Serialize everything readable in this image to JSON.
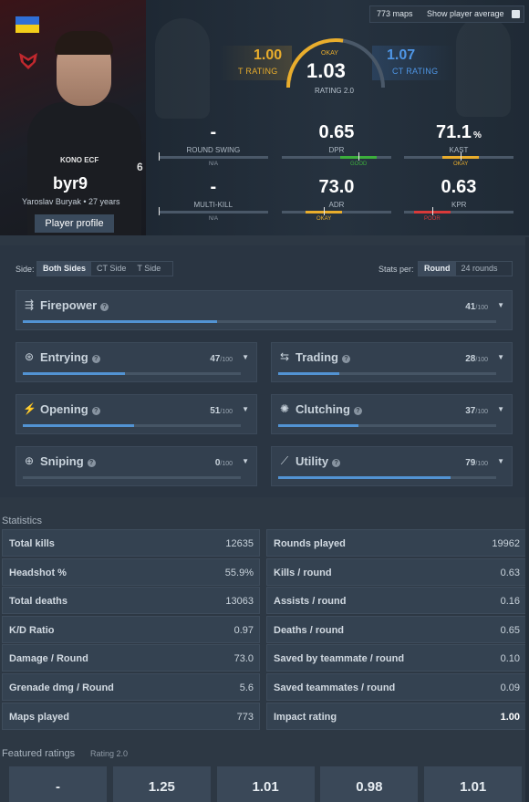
{
  "player": {
    "nickname": "byr9",
    "realname": "Yaroslav Buryak • 27 years",
    "profile_button": "Player profile",
    "country_flag": "ukraine-flag",
    "team_logo": "team-logo",
    "jersey_sponsor": "KONO ECF",
    "jersey_number": "6"
  },
  "header": {
    "maps": "773 maps",
    "show_average": "Show player average",
    "t_rating": "1.00",
    "t_rating_label": "T RATING",
    "ct_rating": "1.07",
    "ct_rating_label": "CT RATING",
    "rating_quality": "OKAY",
    "rating": "1.03",
    "rating_label": "RATING 2.0",
    "rating_gauge_fraction": 0.55
  },
  "stats": [
    {
      "value": "-",
      "unit": "",
      "label": "ROUND SWING",
      "quality": "N/A",
      "quality_color": "#8d98a4",
      "marker": 0.0
    },
    {
      "value": "0.65",
      "unit": "",
      "label": "DPR",
      "quality": "GOOD",
      "quality_color": "#3cae3c",
      "marker": 0.7
    },
    {
      "value": "71.1",
      "unit": "%",
      "label": "KAST",
      "quality": "OKAY",
      "quality_color": "#e9ad2c",
      "marker": 0.52
    },
    {
      "value": "-",
      "unit": "",
      "label": "MULTI-KILL",
      "quality": "N/A",
      "quality_color": "#8d98a4",
      "marker": 0.0
    },
    {
      "value": "73.0",
      "unit": "",
      "label": "ADR",
      "quality": "OKAY",
      "quality_color": "#e9ad2c",
      "marker": 0.38
    },
    {
      "value": "0.63",
      "unit": "",
      "label": "KPR",
      "quality": "POOR",
      "quality_color": "#d83a3a",
      "marker": 0.26
    }
  ],
  "filters": {
    "side_label": "Side:",
    "side_tabs": [
      "Both Sides",
      "CT Side",
      "T Side"
    ],
    "side_active": 0,
    "per_label": "Stats per:",
    "per_tabs": [
      "Round",
      "24 rounds"
    ],
    "per_active": 0
  },
  "categories": [
    {
      "name": "Firepower",
      "score": "41",
      "max": "/100",
      "icon": "firepower-icon",
      "glyph": "⇶",
      "fill": 0.41
    },
    {
      "name": "Entrying",
      "score": "47",
      "max": "/100",
      "icon": "entrying-icon",
      "glyph": "⊛",
      "fill": 0.47
    },
    {
      "name": "Trading",
      "score": "28",
      "max": "/100",
      "icon": "trading-icon",
      "glyph": "⇆",
      "fill": 0.28
    },
    {
      "name": "Opening",
      "score": "51",
      "max": "/100",
      "icon": "opening-icon",
      "glyph": "⚡",
      "fill": 0.51
    },
    {
      "name": "Clutching",
      "score": "37",
      "max": "/100",
      "icon": "clutching-icon",
      "glyph": "✺",
      "fill": 0.37
    },
    {
      "name": "Sniping",
      "score": "0",
      "max": "/100",
      "icon": "sniping-icon",
      "glyph": "⊕",
      "fill": 0.0
    },
    {
      "name": "Utility",
      "score": "79",
      "max": "/100",
      "icon": "utility-icon",
      "glyph": "⟋",
      "fill": 0.79
    }
  ],
  "statistics": {
    "title": "Statistics",
    "left": [
      {
        "k": "Total kills",
        "v": "12635"
      },
      {
        "k": "Headshot %",
        "v": "55.9%"
      },
      {
        "k": "Total deaths",
        "v": "13063"
      },
      {
        "k": "K/D Ratio",
        "v": "0.97"
      },
      {
        "k": "Damage / Round",
        "v": "73.0"
      },
      {
        "k": "Grenade dmg / Round",
        "v": "5.6"
      },
      {
        "k": "Maps played",
        "v": "773"
      }
    ],
    "right": [
      {
        "k": "Rounds played",
        "v": "19962"
      },
      {
        "k": "Kills / round",
        "v": "0.63"
      },
      {
        "k": "Assists / round",
        "v": "0.16"
      },
      {
        "k": "Deaths / round",
        "v": "0.65"
      },
      {
        "k": "Saved by teammate / round",
        "v": "0.10"
      },
      {
        "k": "Saved teammates / round",
        "v": "0.09"
      },
      {
        "k": "Impact rating",
        "v": "1.00"
      }
    ]
  },
  "featured": {
    "title": "Featured ratings",
    "subtitle": "Rating 2.0",
    "values": [
      "-",
      "1.25",
      "1.01",
      "0.98",
      "1.01"
    ]
  }
}
